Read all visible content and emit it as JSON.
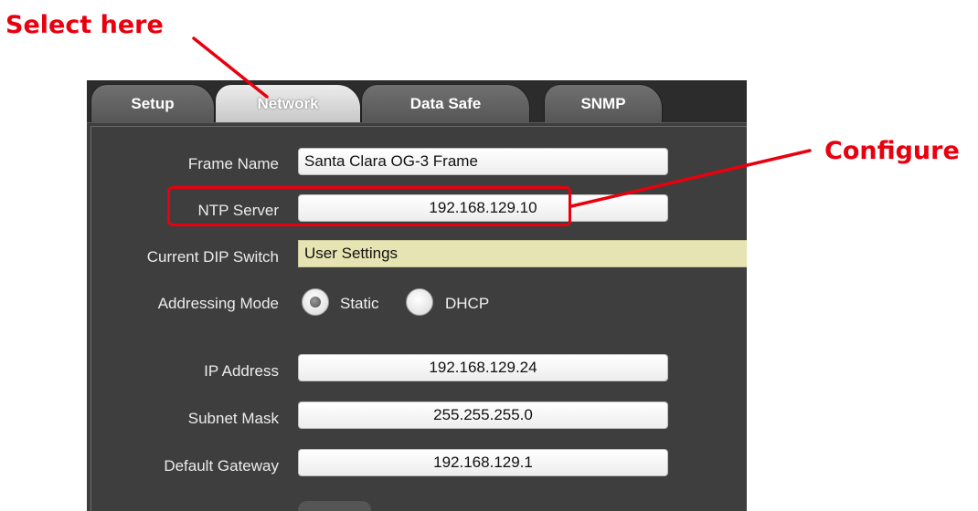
{
  "annotations": {
    "select_here": "Select here",
    "configure": "Configure",
    "color": "#e8000f"
  },
  "tabs": [
    {
      "label": "Setup",
      "active": false
    },
    {
      "label": "Network",
      "active": true
    },
    {
      "label": "Data Safe",
      "active": false
    },
    {
      "label": "SNMP",
      "active": false
    }
  ],
  "form": {
    "frame_name": {
      "label": "Frame Name",
      "value": "Santa Clara OG-3 Frame"
    },
    "ntp_server": {
      "label": "NTP Server",
      "value": "192.168.129.10"
    },
    "dip_switch": {
      "label": "Current DIP Switch",
      "value": "User Settings"
    },
    "addressing_mode": {
      "label": "Addressing Mode",
      "options": [
        "Static",
        "DHCP"
      ],
      "selected": "Static"
    },
    "ip_address": {
      "label": "IP Address",
      "value": "192.168.129.24"
    },
    "subnet_mask": {
      "label": "Subnet Mask",
      "value": "255.255.255.0"
    },
    "default_gateway": {
      "label": "Default Gateway",
      "value": "192.168.129.1"
    }
  }
}
